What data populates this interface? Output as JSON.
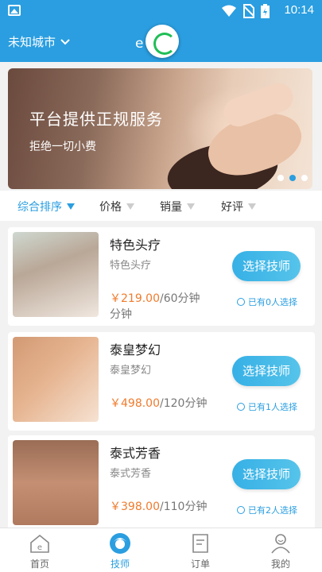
{
  "status_bar": {
    "time": "10:14",
    "icons": [
      "image-icon",
      "wifi-icon",
      "no-sim-icon",
      "battery-charging-icon"
    ]
  },
  "header": {
    "city": "未知城市",
    "title": "e  家"
  },
  "banner": {
    "headline": "平台提供正规服务",
    "subline": "拒绝一切小费",
    "dots": 3,
    "active_dot": 2
  },
  "filters": [
    {
      "label": "综合排序",
      "active": true
    },
    {
      "label": "价格",
      "active": false
    },
    {
      "label": "销量",
      "active": false
    },
    {
      "label": "好评",
      "active": false
    }
  ],
  "services": [
    {
      "name": "特色头疗",
      "desc": "特色头疗",
      "price": "￥219.00",
      "unit": "/60分钟分钟",
      "button": "选择技师",
      "chosen": "已有0人选择"
    },
    {
      "name": "泰皇梦幻",
      "desc": "泰皇梦幻",
      "price": "￥498.00",
      "unit": "/120分钟",
      "button": "选择技师",
      "chosen": "已有1人选择"
    },
    {
      "name": "泰式芳香",
      "desc": "泰式芳香",
      "price": "￥398.00",
      "unit": "/110分钟",
      "button": "选择技师",
      "chosen": "已有2人选择"
    }
  ],
  "tabs": [
    {
      "label": "首页",
      "icon": "home-icon",
      "active": false
    },
    {
      "label": "技师",
      "icon": "therapist-icon",
      "active": true
    },
    {
      "label": "订单",
      "icon": "order-icon",
      "active": false
    },
    {
      "label": "我的",
      "icon": "profile-icon",
      "active": false
    }
  ],
  "colors": {
    "primary": "#2a9ee0",
    "price": "#ef7b2d",
    "loader": "#1fbe55"
  }
}
